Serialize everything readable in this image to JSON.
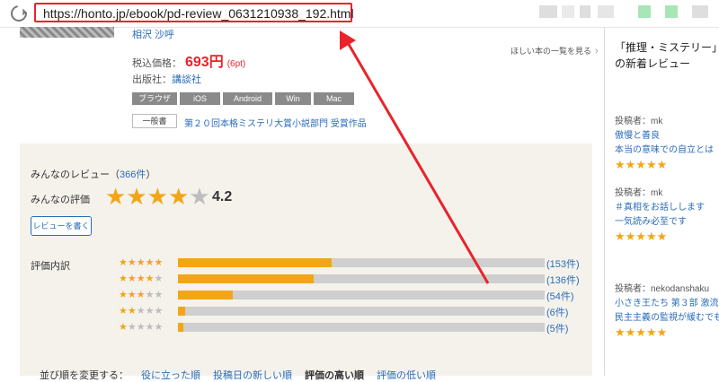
{
  "browser": {
    "url": "https://honto.jp/ebook/pd-review_0631210938_192.html"
  },
  "product": {
    "author": "相沢 沙呼",
    "price_label": "税込価格：",
    "price": "693円",
    "points": "(6pt)",
    "publisher_label": "出版社：",
    "publisher": "講談社",
    "formats": [
      "ブラウザ",
      "iOS",
      "Android",
      "Win",
      "Mac"
    ],
    "badge": "一般書",
    "award": "第２０回本格ミステリ大賞小説部門 受賞作品",
    "wishlist": "ほしい本の一覧を見る"
  },
  "reviews": {
    "title_prefix": "みんなのレビュー（",
    "count": "366件",
    "title_suffix": "）",
    "avg_label": "みんなの評価",
    "avg_value": "4.2",
    "avg_stars_filled": 4,
    "write_button": "レビューを書く",
    "detail_label": "評価内訳",
    "distribution": [
      {
        "stars": 5,
        "count": "(153件)",
        "fraction": 0.42
      },
      {
        "stars": 4,
        "count": "(136件)",
        "fraction": 0.37
      },
      {
        "stars": 3,
        "count": "(54件)",
        "fraction": 0.15
      },
      {
        "stars": 2,
        "count": "(6件)",
        "fraction": 0.02
      },
      {
        "stars": 1,
        "count": "(5件)",
        "fraction": 0.015
      }
    ],
    "sort_label": "並び順を変更する：",
    "sort_options": [
      "役に立った順",
      "投稿日の新しい順",
      "評価の高い順",
      "評価の低い順"
    ]
  },
  "sidebar": {
    "title": "「推理・ミステリー」の新着レビュー",
    "items": [
      {
        "poster": "投稿者：mk",
        "lines": [
          "傲慢と善良",
          "本当の意味での自立とは"
        ],
        "stars": 5
      },
      {
        "poster": "投稿者：mk",
        "lines": [
          "＃真相をお話しします",
          "一気読み必至です"
        ],
        "stars": 5
      },
      {
        "poster": "投稿者：nekodanshaku",
        "lines": [
          "小さき王たち 第３部 激流",
          "民主主義の監視が緩むでも"
        ],
        "stars": 5
      }
    ]
  },
  "colors": {
    "accent": "#f4a517",
    "link": "#2a6cb8",
    "highlight": "#e8232a"
  }
}
